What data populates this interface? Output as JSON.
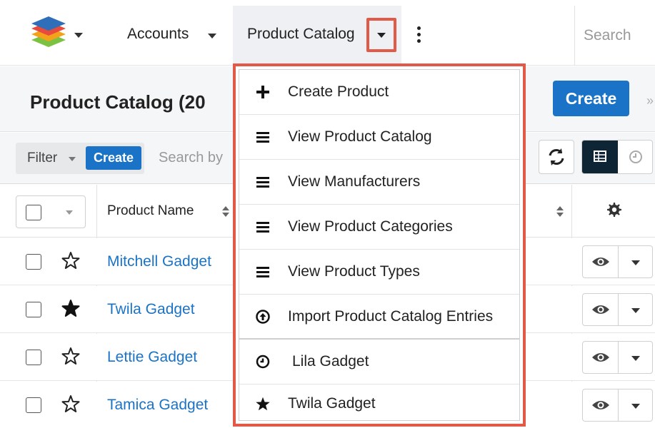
{
  "nav": {
    "accounts_label": "Accounts",
    "product_catalog_label": "Product Catalog",
    "search_placeholder": "Search",
    "icons": [
      "layers-logo-icon",
      "chevron-down-icon",
      "more-vertical-icon"
    ]
  },
  "header": {
    "title": "Product Catalog (20",
    "create_label": "Create",
    "extra": "»"
  },
  "filter": {
    "filter_label": "Filter",
    "create_label": "Create",
    "search_placeholder": "Search by"
  },
  "table": {
    "columns": [
      "Product Name"
    ],
    "rows": [
      {
        "name": "Mitchell Gadget",
        "favorite": false
      },
      {
        "name": "Twila Gadget",
        "favorite": true
      },
      {
        "name": "Lettie Gadget",
        "favorite": false
      },
      {
        "name": "Tamica Gadget",
        "favorite": false
      }
    ]
  },
  "menu": {
    "items": [
      {
        "label": "Create Product",
        "icon": "plus-icon"
      },
      {
        "label": "View Product Catalog",
        "icon": "list-icon"
      },
      {
        "label": "View Manufacturers",
        "icon": "list-icon"
      },
      {
        "label": "View Product Categories",
        "icon": "list-icon"
      },
      {
        "label": "View Product Types",
        "icon": "list-icon"
      },
      {
        "label": "Import Product Catalog Entries",
        "icon": "import-icon"
      },
      {
        "label": "Lila Gadget",
        "icon": "clock-icon"
      },
      {
        "label": "Twila Gadget",
        "icon": "star-icon"
      }
    ]
  },
  "colors": {
    "accent_blue": "#1a73c6",
    "highlight_red": "#e25a47",
    "dark_toggle": "#0d2535"
  }
}
